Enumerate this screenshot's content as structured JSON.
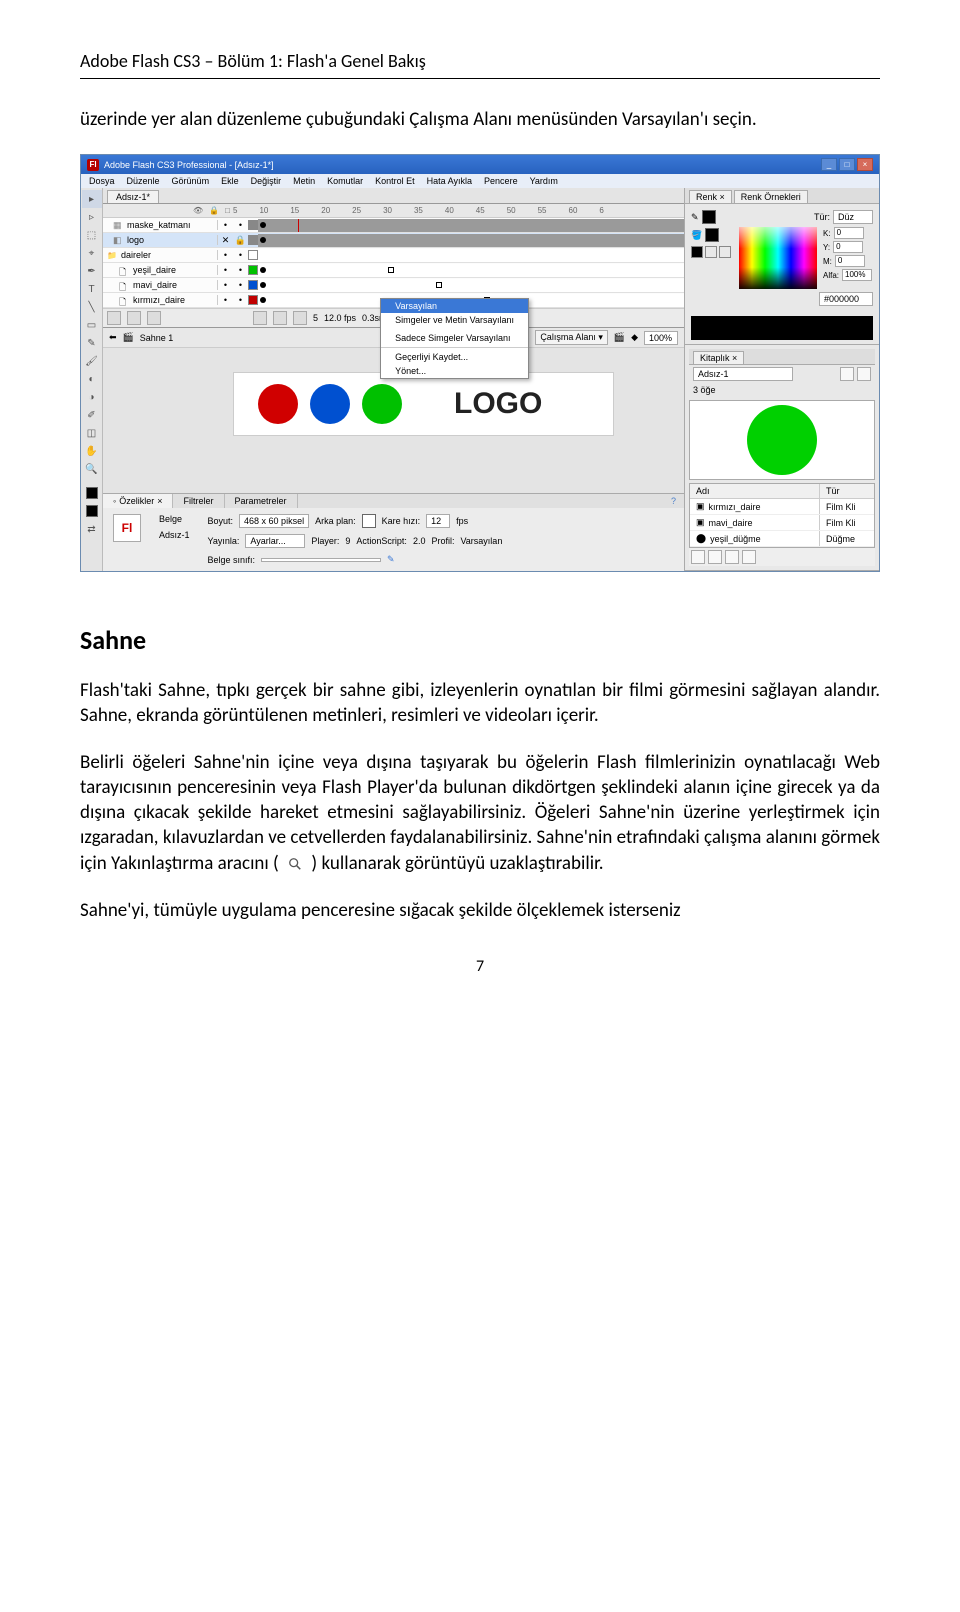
{
  "header": "Adobe Flash CS3 – Bölüm 1: Flash'a Genel Bakış",
  "intro_para": "üzerinde yer alan düzenleme çubuğundaki Çalışma Alanı menüsünden Varsayılan'ı seçin.",
  "app": {
    "title": "Adobe Flash CS3 Professional - [Adsız-1*]",
    "menus": [
      "Dosya",
      "Düzenle",
      "Görünüm",
      "Ekle",
      "Değiştir",
      "Metin",
      "Komutlar",
      "Kontrol Et",
      "Hata Ayıkla",
      "Pencere",
      "Yardım"
    ],
    "doc_tab": "Adsız-1*",
    "ruler_marks": [
      "5",
      "10",
      "15",
      "20",
      "25",
      "30",
      "35",
      "40",
      "45",
      "50",
      "55",
      "60",
      "6"
    ],
    "layers": [
      {
        "name": "maske_katmanı",
        "icon": "mask",
        "gray": true
      },
      {
        "name": "logo",
        "icon": "tween",
        "sel": true,
        "gray": true
      },
      {
        "name": "daireler",
        "icon": "folder"
      },
      {
        "name": "yeşil_daire",
        "icon": "file",
        "color": "#00c000"
      },
      {
        "name": "mavi_daire",
        "icon": "file",
        "color": "#0050d0"
      },
      {
        "name": "kırmızı_daire",
        "icon": "file",
        "color": "#c00000"
      }
    ],
    "timeline_footer": {
      "frame": "5",
      "fps": "12.0 fps",
      "time": "0.3sn"
    },
    "scene": "Sahne 1",
    "workspace_label": "Çalışma Alanı ▾",
    "zoom": "100%",
    "workspace_menu": {
      "items": [
        "Varsayılan",
        "Simgeler ve Metin Varsayılanı",
        "Sadece Simgeler Varsayılanı"
      ],
      "sep_items": [
        "Geçerliyi Kaydet...",
        "Yönet..."
      ]
    },
    "logo_text": "LOGO",
    "circles": [
      "#d00000",
      "#0050d0",
      "#00c000"
    ],
    "props": {
      "tabs": [
        "Özelikler",
        "Filtreler",
        "Parametreler"
      ],
      "type": "Belge",
      "name": "Adsız-1",
      "boyut_label": "Boyut:",
      "boyut": "468 x 60 piksel",
      "arka_label": "Arka plan:",
      "kare_label": "Kare hızı:",
      "kare": "12",
      "fps": "fps",
      "yayinla_label": "Yayınla:",
      "yayinla": "Ayarlar...",
      "player_label": "Player:",
      "player": "9",
      "as_label": "ActionScript:",
      "as": "2.0",
      "profil_label": "Profil:",
      "profil": "Varsayılan",
      "sinif_label": "Belge sınıfı:"
    },
    "color_panel": {
      "tabs": [
        "Renk",
        "Renk Örnekleri"
      ],
      "tur_label": "Tür:",
      "tur": "Düz",
      "k": {
        "label": "K:",
        "val": "0"
      },
      "y": {
        "label": "Y:",
        "val": "0"
      },
      "m": {
        "label": "M:",
        "val": "0"
      },
      "alfa": {
        "label": "Alfa:",
        "val": "100%"
      },
      "hex": "#000000"
    },
    "lib": {
      "tab": "Kitaplık",
      "doc": "Adsız-1",
      "count": "3 öğe",
      "name_header": "Adı",
      "type_header": "Tür",
      "items": [
        {
          "name": "kırmızı_daire",
          "type": "Film Kli"
        },
        {
          "name": "mavi_daire",
          "type": "Film Kli"
        },
        {
          "name": "yeşil_düğme",
          "type": "Düğme"
        }
      ]
    }
  },
  "section_title": "Sahne",
  "body_p1": "Flash'taki Sahne, tıpkı gerçek bir sahne gibi, izleyenlerin oynatılan bir filmi görmesini sağlayan alandır. Sahne, ekranda görüntülenen metinleri, resimleri ve videoları içerir.",
  "body_p2a": "Belirli öğeleri Sahne'nin içine veya dışına taşıyarak bu öğelerin Flash filmlerinizin oynatılacağı Web tarayıcısının penceresinin veya Flash Player'da bulunan dikdörtgen şeklindeki alanın içine girecek ya da dışına çıkacak şekilde hareket etmesini sağlayabilirsiniz. Öğeleri Sahne'nin üzerine yerleştirmek için ızgaradan, kılavuzlardan ve cetvellerden faydalanabilirsiniz. Sahne'nin etrafındaki çalışma alanını görmek için Yakınlaştırma aracını (",
  "body_p2b": ") kullanarak görüntüyü uzaklaştırabilir.",
  "body_p3": "Sahne'yi, tümüyle uygulama penceresine sığacak şekilde ölçeklemek isterseniz",
  "page_num": "7"
}
